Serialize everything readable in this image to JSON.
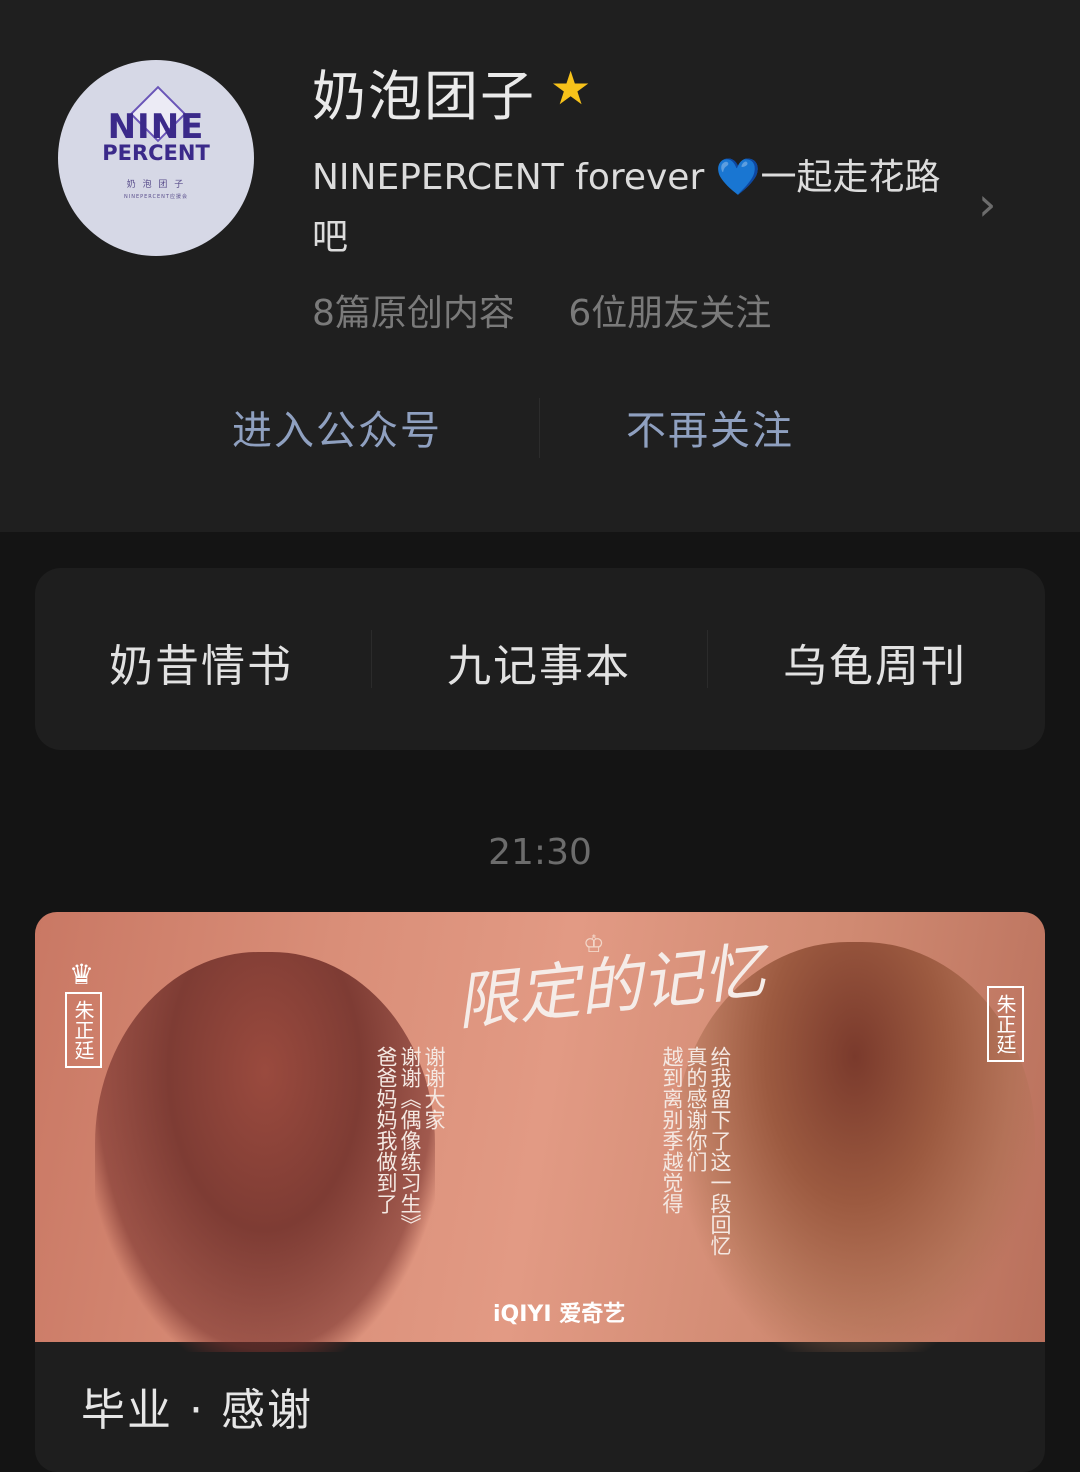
{
  "account": {
    "name": "奶泡团子",
    "avatar_line1": "NINE",
    "avatar_line2": "PERCENT",
    "avatar_line3": "奶 泡 团 子",
    "avatar_line4": "NINEPERCENT应援会",
    "bio_part1": "NINEPERCENT forever ",
    "bio_emoji": "💙",
    "bio_part2": "一起走花路吧",
    "original_count": "8篇原创内容",
    "friends_following": "6位朋友关注"
  },
  "actions": {
    "enter": "进入公众号",
    "unfollow": "不再关注"
  },
  "menu": [
    "奶昔情书",
    "九记事本",
    "乌龟周刊"
  ],
  "feed": {
    "time": "21:30",
    "article": {
      "banner_title": "限定的记忆",
      "left_tag": "朱正廷",
      "right_tag": "朱正廷",
      "left_lines": [
        "谢谢大家",
        "谢谢《偶像练习生》",
        "爸爸妈妈我做到了"
      ],
      "right_lines": [
        "给我留下了这一段回忆",
        "真的感谢你们",
        "越到离别季越觉得"
      ],
      "brand": "iQIYI 爱奇艺",
      "title": "毕业 · 感谢"
    }
  },
  "colors": {
    "background": "#141414",
    "header": "#1f1f1f",
    "action_text": "#8fa0c0",
    "star": "#f7c21a"
  }
}
